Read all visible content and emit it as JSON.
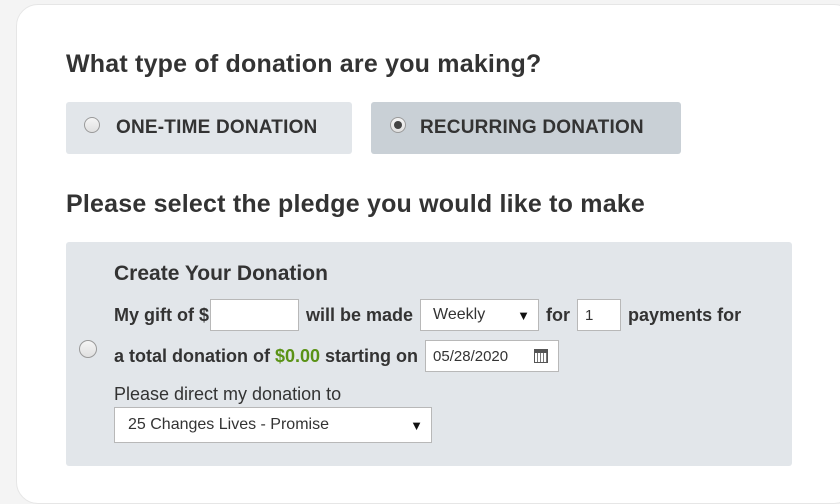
{
  "donation_type": {
    "question": "What type of donation are you making?",
    "options": [
      {
        "label": "ONE-TIME DONATION",
        "selected": false
      },
      {
        "label": "RECURRING DONATION",
        "selected": true
      }
    ]
  },
  "pledge": {
    "heading": "Please select the pledge you would like to make",
    "create": {
      "title": "Create Your Donation",
      "gift_prefix": "My gift of $",
      "amount_value": "",
      "will_be_made": "will be made",
      "frequency_selected": "Weekly",
      "for_label": "for",
      "payment_count": "1",
      "payments_for": "payments for",
      "total_prefix": "a total donation of",
      "total_amount": "$0.00",
      "starting_on": "starting on",
      "start_date": "05/28/2020",
      "direct_label": "Please direct my donation to",
      "program_selected": "25 Changes Lives - Promise"
    }
  },
  "icons": {
    "dropdown": "chevron-down-icon",
    "calendar": "calendar-icon"
  },
  "colors": {
    "accent_green": "#5a9216",
    "panel_bg": "#e2e6ea",
    "selected_toggle_bg": "#c9d0d6"
  }
}
